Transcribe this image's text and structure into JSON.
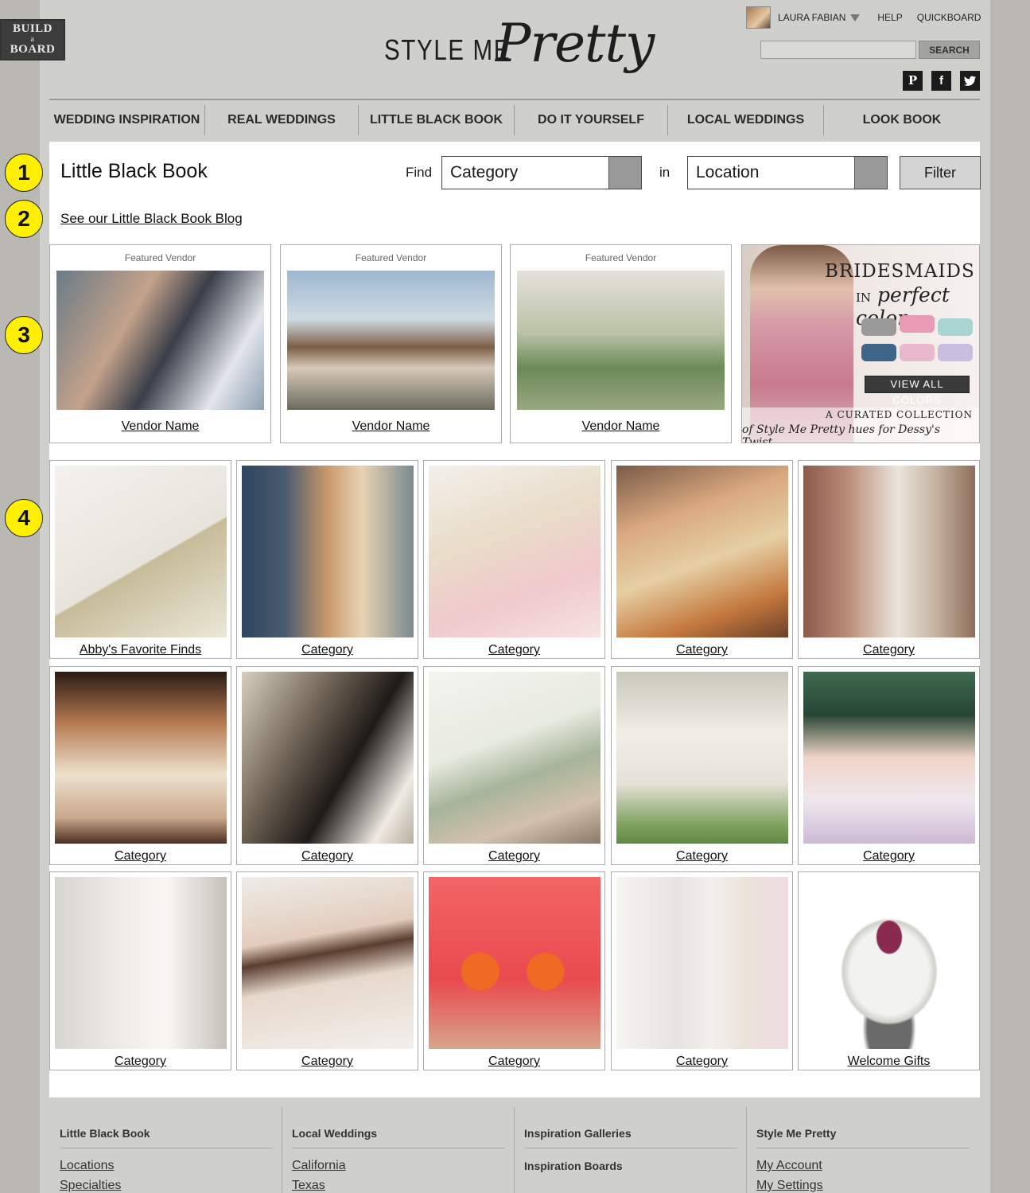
{
  "brand": {
    "build_board": [
      "BUILD",
      "a",
      "BOARD"
    ],
    "logo_left": "STYLE ME",
    "logo_right": "Pretty"
  },
  "userbar": {
    "user_name": "LAURA FABIAN",
    "help": "HELP",
    "quickboard": "QUICKBOARD"
  },
  "search": {
    "button": "SEARCH",
    "placeholder": ""
  },
  "social": {
    "pinterest": "P",
    "facebook": "f",
    "twitter": "t"
  },
  "nav": [
    "WEDDING INSPIRATION",
    "REAL WEDDINGS",
    "LITTLE BLACK BOOK",
    "DO IT YOURSELF",
    "LOCAL WEDDINGS",
    "LOOK BOOK"
  ],
  "markers": [
    "1",
    "2",
    "3",
    "4"
  ],
  "page": {
    "title": "Little Black Book",
    "find_label": "Find",
    "category_select": "Category",
    "in_label": "in",
    "location_select": "Location",
    "filter_button": "Filter",
    "blog_link": "See our Little Black Book Blog"
  },
  "featured": [
    {
      "caption": "Featured Vendor",
      "name": "Vendor Name"
    },
    {
      "caption": "Featured Vendor",
      "name": "Vendor Name"
    },
    {
      "caption": "Featured Vendor",
      "name": "Vendor Name"
    }
  ],
  "ad": {
    "headline": "BRIDESMAIDS",
    "in_word": "IN",
    "subheadline": "perfect color",
    "button": "VIEW ALL COLORS",
    "curated_line1": "A CURATED COLLECTION",
    "curated_line2": "of Style Me Pretty hues for Dessy's Twist",
    "swatch_colors": [
      "#9a9a9a",
      "#e99bb5",
      "#a8d4d2",
      "#3e6688",
      "#e8b8cc",
      "#c9bde0"
    ]
  },
  "grid": [
    "Abby's Favorite Finds",
    "Category",
    "Category",
    "Category",
    "Category",
    "Category",
    "Category",
    "Category",
    "Category",
    "Category",
    "Category",
    "Category",
    "Category",
    "Category",
    "Welcome Gifts"
  ],
  "footer": [
    {
      "heading": "Little Black Book",
      "links": [
        "Locations",
        "Specialties"
      ]
    },
    {
      "heading": "Local Weddings",
      "links": [
        "California",
        "Texas"
      ]
    },
    {
      "heading": "Inspiration Galleries",
      "bold_items": [
        "Inspiration Boards"
      ]
    },
    {
      "heading": "Style Me Pretty",
      "links": [
        "My Account",
        "My Settings"
      ]
    }
  ]
}
